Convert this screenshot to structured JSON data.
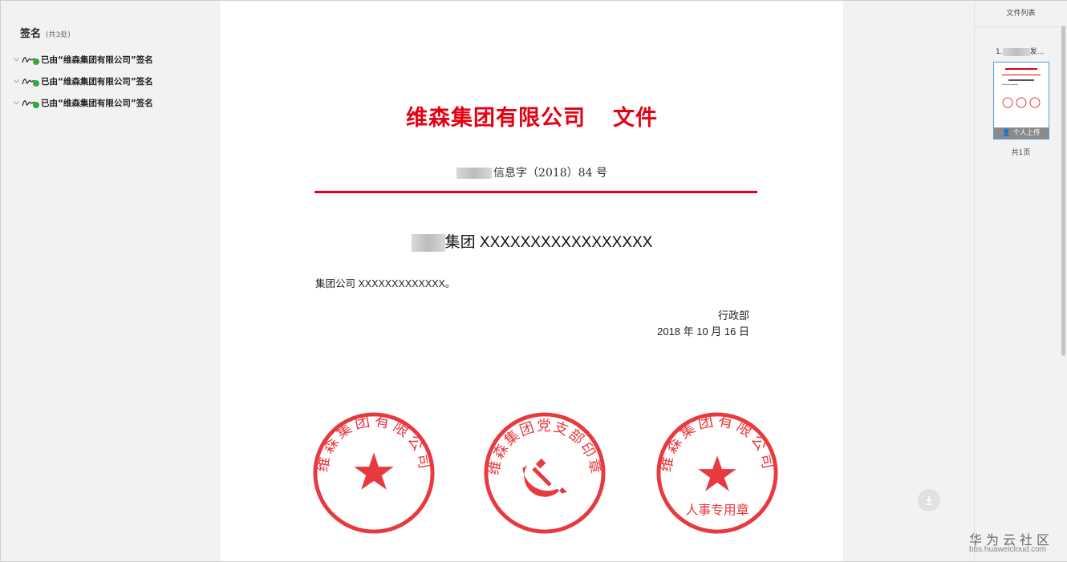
{
  "signature_panel": {
    "title": "签名",
    "count": "(共3处)",
    "items": [
      {
        "label": "已由“维森集团有限公司”签名"
      },
      {
        "label": "已由“维森集团有限公司”签名"
      },
      {
        "label": "已由“维森集团有限公司”签名"
      }
    ]
  },
  "document": {
    "title": "维森集团有限公司    文件",
    "number": "信息字（2018）84 号",
    "heading": "集团 XXXXXXXXXXXXXXXXX",
    "body": "集团公司 XXXXXXXXXXXXX。",
    "department": "行政部",
    "date": "2018 年 10 月 16 日"
  },
  "seals": [
    {
      "text": "维森集团有限公司",
      "center": "star",
      "bottom": ""
    },
    {
      "text": "维森集团党支部印章",
      "center": "hammer-sickle",
      "bottom": ""
    },
    {
      "text": "维森集团有限公司",
      "center": "star",
      "bottom": "人事专用章"
    }
  ],
  "file_list": {
    "header": "文件列表",
    "file_name": "1.",
    "file_name_suffix": "发...",
    "thumb_tag": "个人上传",
    "page_count": "共1页"
  },
  "watermark": {
    "title": "华为云社区",
    "url": "bbs.huaweicloud.com"
  },
  "colors": {
    "accent_red": "#e60012",
    "seal_red": "#e8393f",
    "check_green": "#2eaa3e",
    "thumb_border": "#5b9bd5"
  }
}
